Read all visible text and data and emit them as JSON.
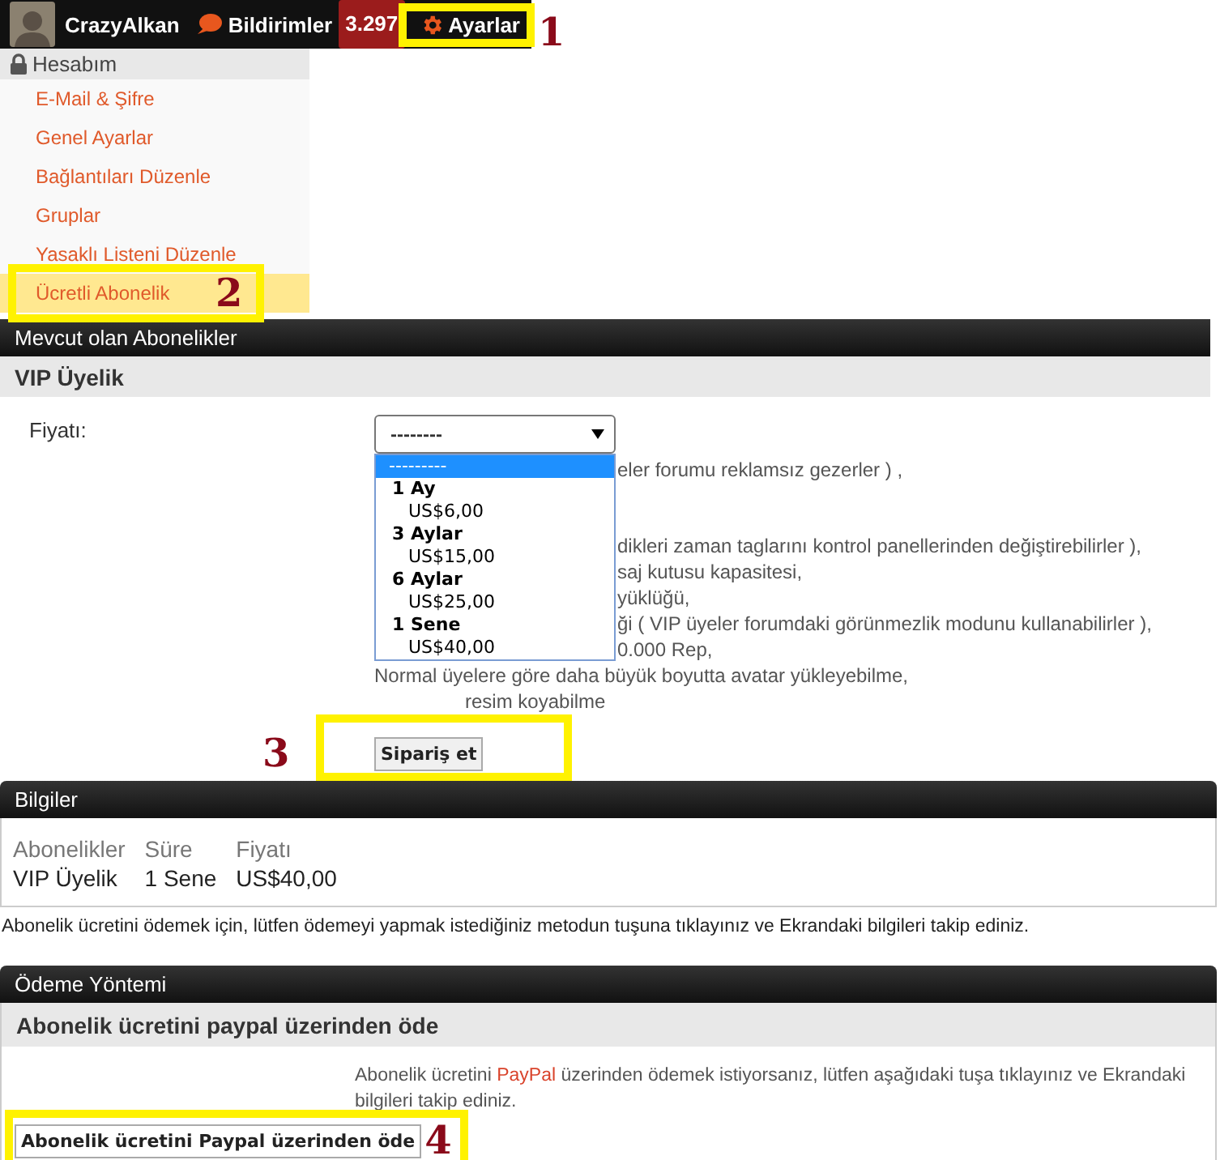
{
  "top_bar": {
    "username": "CrazyAlkan",
    "notifications": {
      "label": "Bildirimler",
      "count": "3.297"
    },
    "settings": {
      "label": "Ayarlar",
      "highlighted": true,
      "marker": "1"
    }
  },
  "sidebar": {
    "title": "Hesabım",
    "items": [
      {
        "label": "E-Mail & Şifre",
        "selected": false,
        "highlighted": false
      },
      {
        "label": "Genel Ayarlar",
        "selected": false,
        "highlighted": false
      },
      {
        "label": "Bağlantıları Düzenle",
        "selected": false,
        "highlighted": false
      },
      {
        "label": "Gruplar",
        "selected": false,
        "highlighted": false
      },
      {
        "label": "Yasaklı Listeni Düzenle",
        "selected": false,
        "highlighted": false
      },
      {
        "label": "Ücretli Abonelik",
        "selected": true,
        "highlighted": true,
        "marker": "2"
      }
    ]
  },
  "subscriptions": {
    "title": "Mevcut olan Abonelikler",
    "plan": {
      "title": "VIP Üyelik",
      "price_label": "Fiyatı:",
      "select": {
        "value": "--------",
        "expanded": true,
        "options": [
          {
            "label": "---------",
            "selected": true
          }
        ],
        "groups": [
          {
            "label": "1 Ay",
            "options": [
              {
                "label": "US$6,00",
                "selected": false
              }
            ]
          },
          {
            "label": "3 Aylar",
            "options": [
              {
                "label": "US$15,00",
                "selected": false
              }
            ]
          },
          {
            "label": "6 Aylar",
            "options": [
              {
                "label": "US$25,00",
                "selected": false
              }
            ]
          },
          {
            "label": "1 Sene",
            "options": [
              {
                "label": "US$40,00",
                "selected": false
              }
            ]
          }
        ]
      },
      "features": [
        {
          "text": "eler forumu reklamsız gezerler ) ,",
          "kind": "covered"
        },
        {
          "text": "dikleri zaman taglarını kontrol panellerinden değiştirebilirler ),",
          "kind": "covered-gap"
        },
        {
          "text": "saj kutusu kapasitesi,",
          "kind": "covered"
        },
        {
          "text": "yüklüğü,",
          "kind": "covered"
        },
        {
          "text": "ği ( VIP üyeler forumdaki görünmezlik modunu kullanabilirler ),",
          "kind": "covered"
        },
        {
          "text": "0.000 Rep,",
          "kind": "covered"
        },
        {
          "text": "Normal üyelere göre daha büyük boyutta avatar yükleyebilme,",
          "kind": "open"
        },
        {
          "text": "resim koyabilme",
          "kind": "marked"
        }
      ],
      "order_button": {
        "label": "Sipariş et",
        "highlighted": true,
        "marker": "3"
      }
    }
  },
  "info": {
    "title": "Bilgiler",
    "columns": [
      {
        "header": "Abonelikler",
        "value": "VIP Üyelik"
      },
      {
        "header": "Süre",
        "value": "1 Sene"
      },
      {
        "header": "Fiyatı",
        "value": "US$40,00"
      }
    ]
  },
  "instructions": "Abonelik ücretini ödemek için, lütfen ödemeyi yapmak istediğiniz metodun tuşuna tıklayınız ve Ekrandaki bilgileri takip ediniz.",
  "payment": {
    "title": "Ödeme Yöntemi",
    "method": {
      "title": "Abonelik ücretini paypal üzerinden öde",
      "description": {
        "before": "Abonelik ücretini",
        "link": "PayPal",
        "after": "üzerinden ödemek istiyorsanız, lütfen aşağıdaki tuşa tıklayınız ve Ekrandaki bilgileri takip ediniz."
      },
      "button": {
        "label": "Abonelik ücretini Paypal üzerinden öde",
        "highlighted": true,
        "marker": "4"
      }
    }
  }
}
